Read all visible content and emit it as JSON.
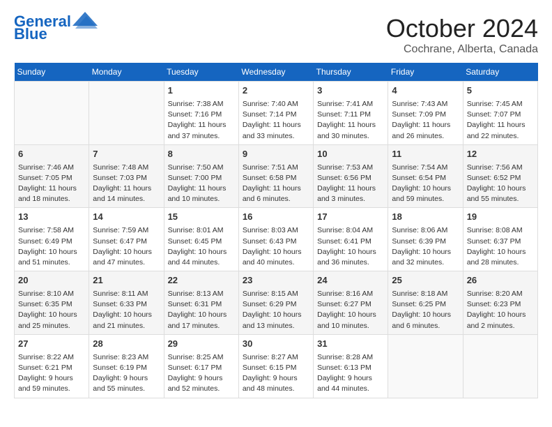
{
  "header": {
    "logo_line1": "General",
    "logo_line2": "Blue",
    "month": "October 2024",
    "location": "Cochrane, Alberta, Canada"
  },
  "days_of_week": [
    "Sunday",
    "Monday",
    "Tuesday",
    "Wednesday",
    "Thursday",
    "Friday",
    "Saturday"
  ],
  "weeks": [
    [
      {
        "day": "",
        "info": ""
      },
      {
        "day": "",
        "info": ""
      },
      {
        "day": "1",
        "info": "Sunrise: 7:38 AM\nSunset: 7:16 PM\nDaylight: 11 hours and 37 minutes."
      },
      {
        "day": "2",
        "info": "Sunrise: 7:40 AM\nSunset: 7:14 PM\nDaylight: 11 hours and 33 minutes."
      },
      {
        "day": "3",
        "info": "Sunrise: 7:41 AM\nSunset: 7:11 PM\nDaylight: 11 hours and 30 minutes."
      },
      {
        "day": "4",
        "info": "Sunrise: 7:43 AM\nSunset: 7:09 PM\nDaylight: 11 hours and 26 minutes."
      },
      {
        "day": "5",
        "info": "Sunrise: 7:45 AM\nSunset: 7:07 PM\nDaylight: 11 hours and 22 minutes."
      }
    ],
    [
      {
        "day": "6",
        "info": "Sunrise: 7:46 AM\nSunset: 7:05 PM\nDaylight: 11 hours and 18 minutes."
      },
      {
        "day": "7",
        "info": "Sunrise: 7:48 AM\nSunset: 7:03 PM\nDaylight: 11 hours and 14 minutes."
      },
      {
        "day": "8",
        "info": "Sunrise: 7:50 AM\nSunset: 7:00 PM\nDaylight: 11 hours and 10 minutes."
      },
      {
        "day": "9",
        "info": "Sunrise: 7:51 AM\nSunset: 6:58 PM\nDaylight: 11 hours and 6 minutes."
      },
      {
        "day": "10",
        "info": "Sunrise: 7:53 AM\nSunset: 6:56 PM\nDaylight: 11 hours and 3 minutes."
      },
      {
        "day": "11",
        "info": "Sunrise: 7:54 AM\nSunset: 6:54 PM\nDaylight: 10 hours and 59 minutes."
      },
      {
        "day": "12",
        "info": "Sunrise: 7:56 AM\nSunset: 6:52 PM\nDaylight: 10 hours and 55 minutes."
      }
    ],
    [
      {
        "day": "13",
        "info": "Sunrise: 7:58 AM\nSunset: 6:49 PM\nDaylight: 10 hours and 51 minutes."
      },
      {
        "day": "14",
        "info": "Sunrise: 7:59 AM\nSunset: 6:47 PM\nDaylight: 10 hours and 47 minutes."
      },
      {
        "day": "15",
        "info": "Sunrise: 8:01 AM\nSunset: 6:45 PM\nDaylight: 10 hours and 44 minutes."
      },
      {
        "day": "16",
        "info": "Sunrise: 8:03 AM\nSunset: 6:43 PM\nDaylight: 10 hours and 40 minutes."
      },
      {
        "day": "17",
        "info": "Sunrise: 8:04 AM\nSunset: 6:41 PM\nDaylight: 10 hours and 36 minutes."
      },
      {
        "day": "18",
        "info": "Sunrise: 8:06 AM\nSunset: 6:39 PM\nDaylight: 10 hours and 32 minutes."
      },
      {
        "day": "19",
        "info": "Sunrise: 8:08 AM\nSunset: 6:37 PM\nDaylight: 10 hours and 28 minutes."
      }
    ],
    [
      {
        "day": "20",
        "info": "Sunrise: 8:10 AM\nSunset: 6:35 PM\nDaylight: 10 hours and 25 minutes."
      },
      {
        "day": "21",
        "info": "Sunrise: 8:11 AM\nSunset: 6:33 PM\nDaylight: 10 hours and 21 minutes."
      },
      {
        "day": "22",
        "info": "Sunrise: 8:13 AM\nSunset: 6:31 PM\nDaylight: 10 hours and 17 minutes."
      },
      {
        "day": "23",
        "info": "Sunrise: 8:15 AM\nSunset: 6:29 PM\nDaylight: 10 hours and 13 minutes."
      },
      {
        "day": "24",
        "info": "Sunrise: 8:16 AM\nSunset: 6:27 PM\nDaylight: 10 hours and 10 minutes."
      },
      {
        "day": "25",
        "info": "Sunrise: 8:18 AM\nSunset: 6:25 PM\nDaylight: 10 hours and 6 minutes."
      },
      {
        "day": "26",
        "info": "Sunrise: 8:20 AM\nSunset: 6:23 PM\nDaylight: 10 hours and 2 minutes."
      }
    ],
    [
      {
        "day": "27",
        "info": "Sunrise: 8:22 AM\nSunset: 6:21 PM\nDaylight: 9 hours and 59 minutes."
      },
      {
        "day": "28",
        "info": "Sunrise: 8:23 AM\nSunset: 6:19 PM\nDaylight: 9 hours and 55 minutes."
      },
      {
        "day": "29",
        "info": "Sunrise: 8:25 AM\nSunset: 6:17 PM\nDaylight: 9 hours and 52 minutes."
      },
      {
        "day": "30",
        "info": "Sunrise: 8:27 AM\nSunset: 6:15 PM\nDaylight: 9 hours and 48 minutes."
      },
      {
        "day": "31",
        "info": "Sunrise: 8:28 AM\nSunset: 6:13 PM\nDaylight: 9 hours and 44 minutes."
      },
      {
        "day": "",
        "info": ""
      },
      {
        "day": "",
        "info": ""
      }
    ]
  ]
}
